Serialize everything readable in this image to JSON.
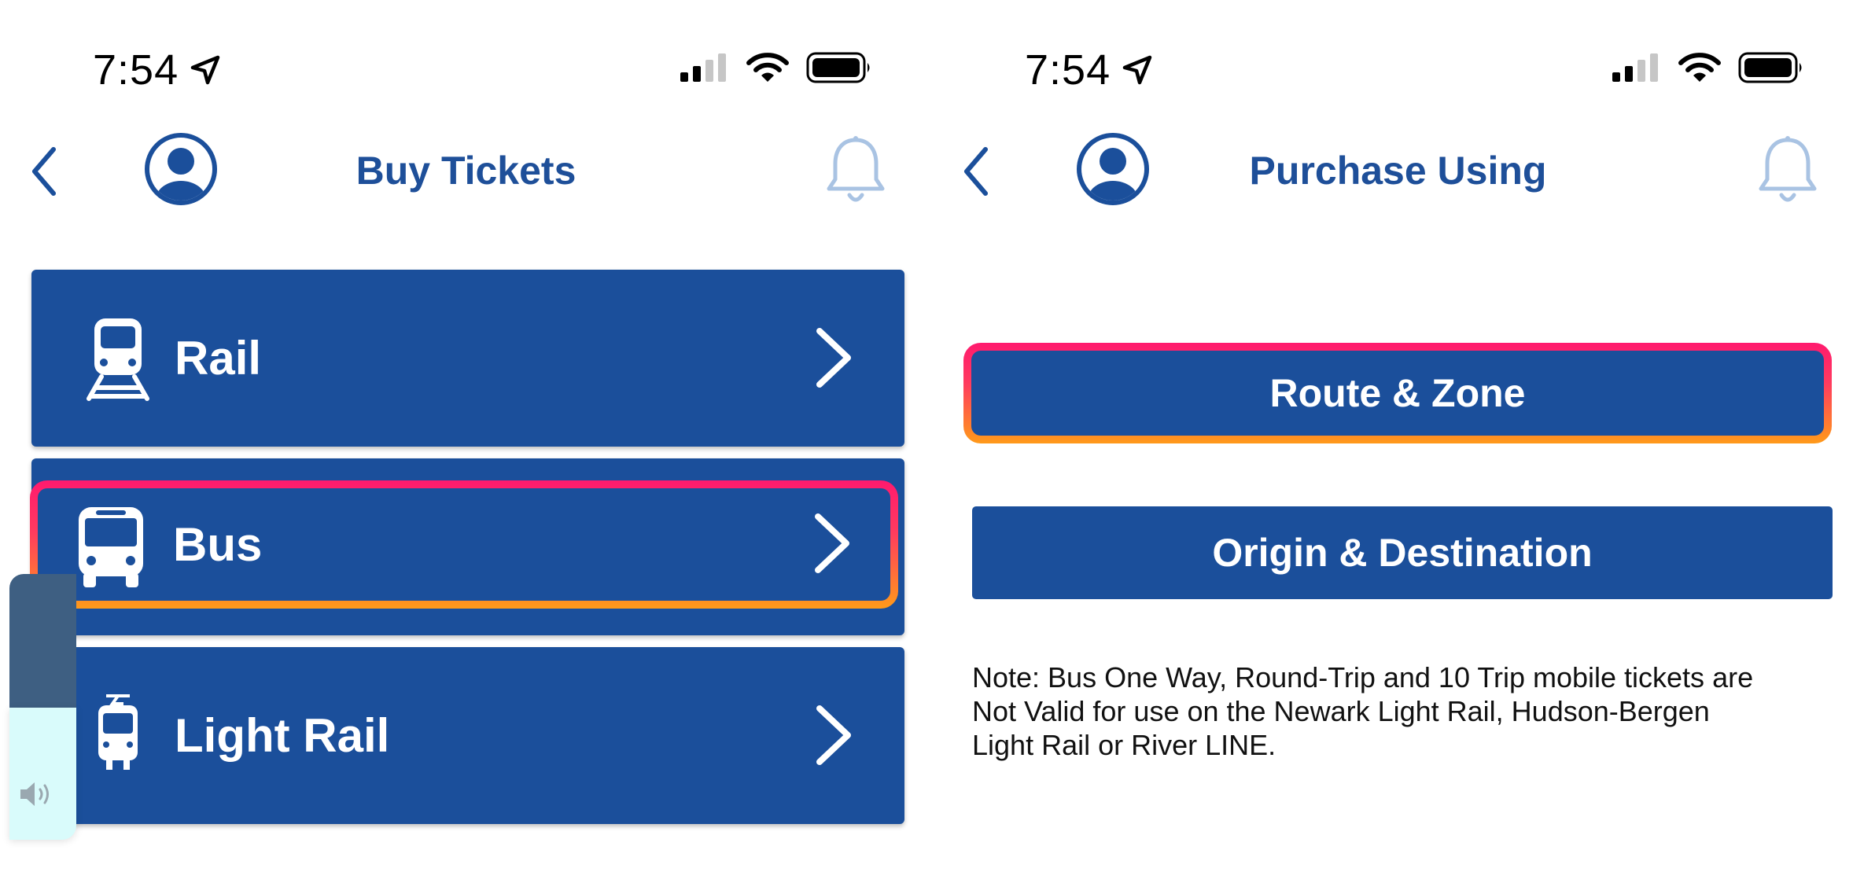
{
  "left_screen": {
    "status": {
      "time": "7:54"
    },
    "header": {
      "title": "Buy Tickets"
    },
    "tiles": [
      {
        "label": "Rail",
        "icon": "train-icon"
      },
      {
        "label": "Bus",
        "icon": "bus-icon"
      },
      {
        "label": "Light Rail",
        "icon": "light-rail-icon"
      }
    ]
  },
  "right_screen": {
    "status": {
      "time": "7:54"
    },
    "header": {
      "title": "Purchase Using"
    },
    "buttons": [
      {
        "label": "Route & Zone"
      },
      {
        "label": "Origin & Destination"
      }
    ],
    "note": "Note: Bus One Way, Round-Trip and 10 Trip mobile tickets are\nNot Valid for use on the Newark Light Rail, Hudson-Bergen\nLight Rail or River LINE."
  },
  "colors": {
    "brand_blue": "#1b4f9b",
    "title_blue": "#1e4f99",
    "bell_light_blue": "#a9c3e3",
    "highlight_gradient": [
      "#ff1a6e",
      "#ff9a1a"
    ]
  }
}
